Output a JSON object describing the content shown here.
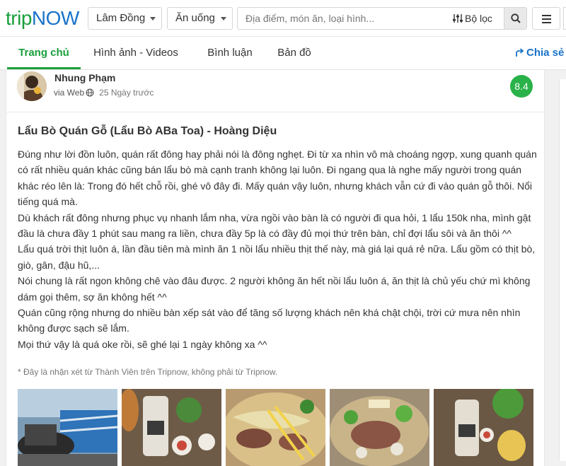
{
  "header": {
    "logo_part1": "trip",
    "logo_part2": "NOW",
    "location_select": "Lâm Đồng",
    "category_select": "Ăn uống",
    "search_placeholder": "Địa điểm, món ăn, loại hình...",
    "filter_label": "Bộ lọc"
  },
  "tabs": [
    {
      "label": "Trang chủ",
      "active": true
    },
    {
      "label": "Hình ảnh - Videos",
      "active": false
    },
    {
      "label": "Bình luận",
      "active": false
    },
    {
      "label": "Bản đồ",
      "active": false
    }
  ],
  "share_label": "Chia sẻ",
  "review": {
    "author": "Nhung Phạm",
    "via": "via Web",
    "time": "25 Ngày trước",
    "score": "8.4",
    "title": "Lẩu Bò Quán Gỗ (Lẩu Bò ABa Toa) - Hoàng Diệu",
    "paragraphs": [
      "Đúng như lời đồn luôn, quán rất đông hay phải nói là đông nghẹt. Đi từ xa nhìn vô mà choáng ngợp, xung quanh quán có rất nhiều quán khác cũng bán lẩu bò mà cạnh tranh không lại luôn. Đi ngang qua là nghe mấy người trong quán khác réo lên là: Trong đó hết chỗ rồi, ghé vô đây đi. Mấy quán vậy luôn, nhưng khách vẫn cứ đi vào quán gỗ thôi. Nổi tiếng quá mà.",
      "Dù khách rất đông nhưng phục vụ nhanh lắm nha, vừa ngồi vào bàn là có người đi qua hỏi, 1 lẩu 150k nha, mình gật đầu là chưa đầy 1 phút sau mang ra liền, chưa đầy 5p là có đầy đủ mọi thứ trên bàn, chỉ đợi lẩu sôi và ăn thôi ^^",
      "Lẩu quá trời thịt luôn á, lần đầu tiên mà mình ăn 1 nồi lẩu nhiều thịt thế này, mà giá lại quá rẻ nữa. Lẩu gồm có thịt bò, giò, gân, đậu hũ,...",
      "Nói chung là rất ngon không chê vào đâu được. 2 người không ăn hết nồi lẩu luôn á, ăn thịt là chủ yếu chứ mì không dám gọi thêm, sợ ăn không hết ^^",
      "Quán cũng rộng nhưng do nhiều bàn xếp sát vào để tăng số lượng khách nên khá chật chội, trời cứ mưa nên nhìn không được sạch sẽ lắm.",
      "Mọi thứ vậy là quá oke rồi, sẽ ghé lại 1 ngày không xa ^^"
    ],
    "disclaimer": "* Đây là nhận xét từ Thành Viên trên Tripnow, không phải từ Tripnow."
  },
  "colors": {
    "brand_green": "#1a9f3b",
    "brand_blue": "#1a73c8",
    "score_green": "#2ab24a"
  }
}
